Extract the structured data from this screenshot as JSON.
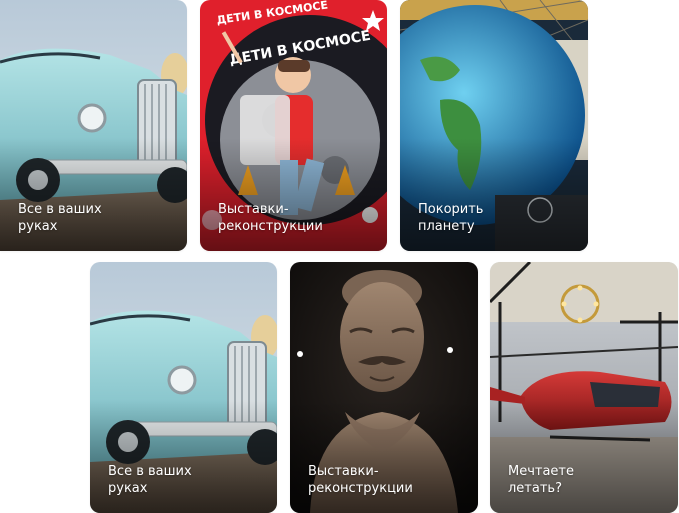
{
  "cards": [
    {
      "caption": "Все в ваших\nруках",
      "art": "car"
    },
    {
      "caption": "Выставки-\nреконструкции",
      "art": "space-kid",
      "poster_title": "ДЕТИ В КОСМОСЕ"
    },
    {
      "caption": "Покорить\nпланету",
      "art": "globe"
    },
    {
      "caption": "Все в ваших\nруках",
      "art": "car"
    },
    {
      "caption": "Выставки-\nреконструкции",
      "art": "warrior"
    },
    {
      "caption": "Мечтаете\nлетать?",
      "art": "helicopter"
    }
  ],
  "colors": {
    "caption_text": "#ffffff",
    "poster_red": "#e0202c",
    "car_blue": "#8fd0d6"
  }
}
